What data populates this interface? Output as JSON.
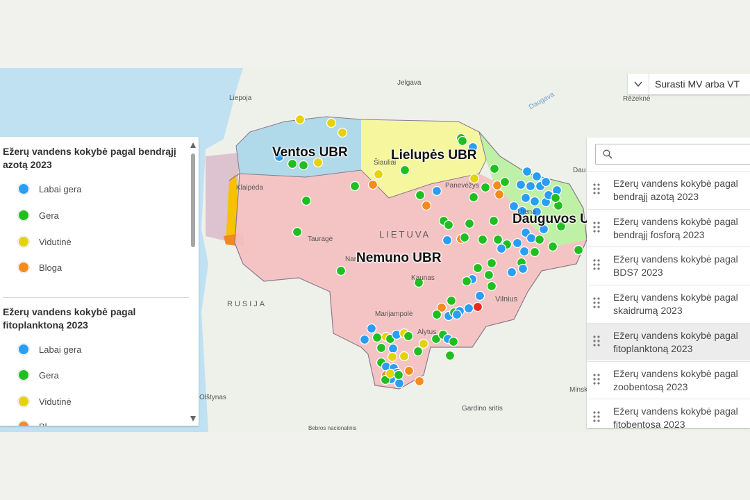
{
  "search": {
    "label": "Surasti MV arba VT"
  },
  "map": {
    "basins": [
      {
        "key": "ventos",
        "label": "Ventos UBR",
        "color": "#a9d6ea"
      },
      {
        "key": "lielupes",
        "label": "Lielupės UBR",
        "color": "#f4f59a"
      },
      {
        "key": "nemuno",
        "label": "Nemuno UBR",
        "color": "#f3c1c3"
      },
      {
        "key": "dauguvos",
        "label": "Dauguvos UBR",
        "color": "#b8ef9e"
      }
    ],
    "country_label": "LIETUVA",
    "neighbor_label": "RUSIJA",
    "places": [
      "Jelgava",
      "Liepoja",
      "Daugava",
      "Rēzeknė",
      "Šiauliai",
      "Panevėžys",
      "Klaipėda",
      "Tauragė",
      "Kaunas",
      "Vilnius",
      "Marijampolė",
      "Alytus",
      "Olštynas",
      "Gardino sritis",
      "Minsk",
      "Bebros nacionalinis",
      "Nar",
      "Utena",
      "Dau"
    ],
    "status_colors": {
      "labai_gera": "#2a9df4",
      "gera": "#1fbf1f",
      "vidutine": "#e6d20c",
      "bloga": "#f58a1f",
      "bloga_red": "#e8291e"
    }
  },
  "legend": {
    "sections": [
      {
        "title": "Ežerų vandens kokybė pagal bendrąjį azotą 2023",
        "items": [
          {
            "label": "Labai gera",
            "color": "#2a9df4"
          },
          {
            "label": "Gera",
            "color": "#1fbf1f"
          },
          {
            "label": "Vidutinė",
            "color": "#e6d20c"
          },
          {
            "label": "Bloga",
            "color": "#f58a1f"
          }
        ]
      },
      {
        "title": "Ežerų vandens kokybė pagal fitoplanktoną 2023",
        "items": [
          {
            "label": "Labai gera",
            "color": "#2a9df4"
          },
          {
            "label": "Gera",
            "color": "#1fbf1f"
          },
          {
            "label": "Vidutinė",
            "color": "#e6d20c"
          },
          {
            "label": "Bl",
            "color": "#f58a1f"
          }
        ]
      }
    ]
  },
  "layers": {
    "search_placeholder": "",
    "items": [
      "Ežerų vandens kokybė pagal bendrąjį azotą 2023",
      "Ežerų vandens kokybė pagal bendrąjį fosforą 2023",
      "Ežerų vandens kokybė pagal BDS7 2023",
      "Ežerų vandens kokybė pagal skaidrumą 2023",
      "Ežerų vandens kokybė pagal fitoplanktoną 2023",
      "Ežerų vandens kokybė pagal zoobentosą 2023",
      "Ežerų vandens kokybė pagal fitobentosą 2023"
    ],
    "selected_index": 4
  }
}
